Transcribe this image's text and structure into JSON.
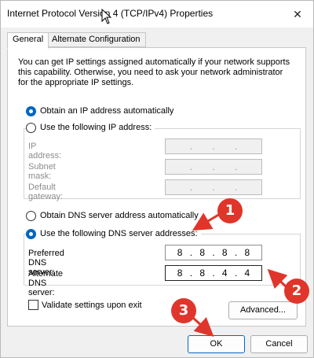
{
  "window": {
    "title": "Internet Protocol Version 4 (TCP/IPv4) Properties",
    "close_glyph": "✕"
  },
  "tabs": [
    {
      "label": "General"
    },
    {
      "label": "Alternate Configuration"
    }
  ],
  "info_text": "You can get IP settings assigned automatically if your network supports this capability. Otherwise, you need to ask your network administrator for the appropriate IP settings.",
  "ip_options": {
    "auto_label": "Obtain an IP address automatically",
    "manual_label": "Use the following IP address:",
    "selected": "auto"
  },
  "ip_fields": {
    "ip_address": "IP address:",
    "subnet_mask": "Subnet mask:",
    "default_gateway": "Default gateway:"
  },
  "dns_options": {
    "auto_label": "Obtain DNS server address automatically",
    "manual_label": "Use the following DNS server addresses:",
    "selected": "manual"
  },
  "dns_fields": {
    "preferred_label": "Preferred DNS server:",
    "preferred_value": [
      "8",
      "8",
      "8",
      "8"
    ],
    "alternate_label": "Alternate DNS server:",
    "alternate_value": [
      "8",
      "8",
      "4",
      "4"
    ]
  },
  "validate_label": "Validate settings upon exit",
  "buttons": {
    "advanced": "Advanced...",
    "ok": "OK",
    "cancel": "Cancel"
  },
  "annotations": {
    "badge1": "1",
    "badge2": "2",
    "badge3": "3",
    "color": "#e0352b"
  }
}
